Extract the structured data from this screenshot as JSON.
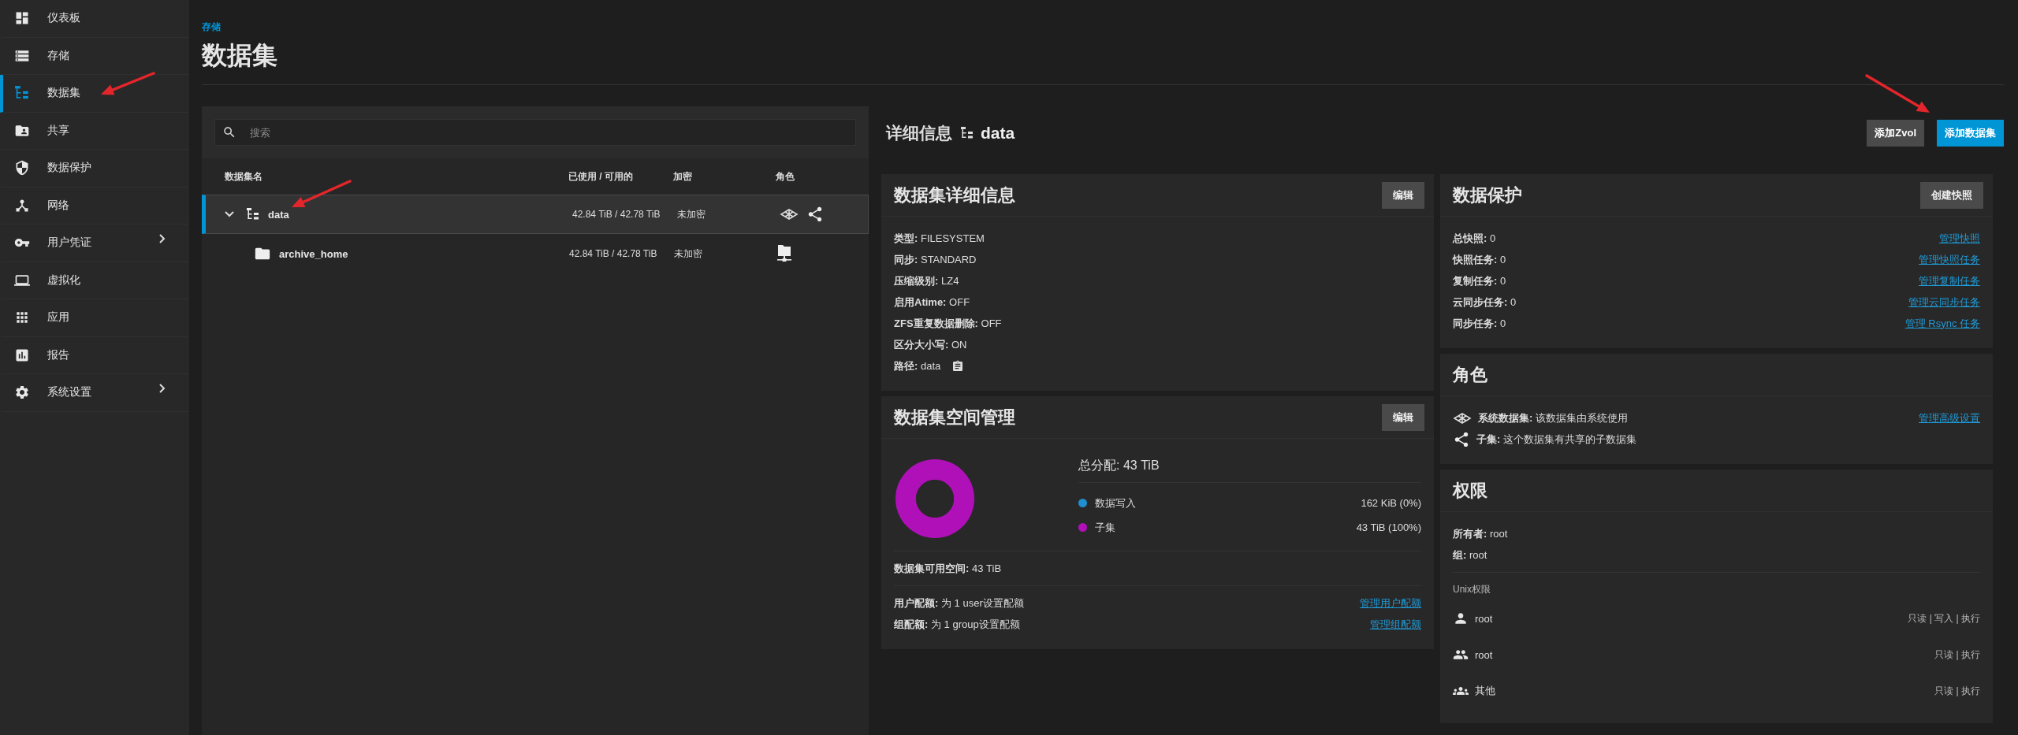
{
  "sidebar": {
    "items": [
      {
        "kind": "dashboard",
        "label": "仪表板",
        "selected": false,
        "chevron": false
      },
      {
        "kind": "storage",
        "label": "存储",
        "selected": false,
        "chevron": false
      },
      {
        "kind": "datasets",
        "label": "数据集",
        "selected": true,
        "chevron": false
      },
      {
        "kind": "shares",
        "label": "共享",
        "selected": false,
        "chevron": false
      },
      {
        "kind": "protection",
        "label": "数据保护",
        "selected": false,
        "chevron": false
      },
      {
        "kind": "network",
        "label": "网络",
        "selected": false,
        "chevron": false
      },
      {
        "kind": "credentials",
        "label": "用户凭证",
        "selected": false,
        "chevron": true
      },
      {
        "kind": "virtualization",
        "label": "虚拟化",
        "selected": false,
        "chevron": false
      },
      {
        "kind": "apps",
        "label": "应用",
        "selected": false,
        "chevron": false
      },
      {
        "kind": "reports",
        "label": "报告",
        "selected": false,
        "chevron": false
      },
      {
        "kind": "settings",
        "label": "系统设置",
        "selected": false,
        "chevron": true
      }
    ]
  },
  "header": {
    "breadcrumb": "存储",
    "title": "数据集"
  },
  "tree": {
    "search": {
      "placeholder": "搜索"
    },
    "columns": [
      "数据集名",
      "已使用 / 可用的",
      "加密",
      "角色"
    ],
    "rows": [
      {
        "kind": "dataset",
        "name": "data",
        "used": "42.84 TiB / 42.78 TiB",
        "encryption": "未加密",
        "selected": true,
        "expanded": true,
        "roles": [
          {
            "kind": "system"
          },
          {
            "kind": "share"
          }
        ],
        "children": [
          {
            "kind": "folder",
            "name": "archive_home",
            "used": "42.84 TiB / 42.78 TiB",
            "encryption": "未加密",
            "selected": false,
            "roles": [
              {
                "kind": "nfs"
              }
            ]
          }
        ]
      }
    ]
  },
  "details": {
    "title": "详细信息",
    "dataset": "data",
    "buttons": [
      {
        "label": "添加Zvol",
        "primary": false
      },
      {
        "label": "添加数据集",
        "primary": true
      }
    ]
  },
  "dataset_details": {
    "title": "数据集详细信息",
    "button": "编辑",
    "fields": [
      {
        "label": "类型:",
        "value": "FILESYSTEM",
        "copyable": false
      },
      {
        "label": "同步:",
        "value": "STANDARD",
        "copyable": false
      },
      {
        "label": "压缩级别:",
        "value": "LZ4",
        "copyable": false
      },
      {
        "label": "启用Atime:",
        "value": "OFF",
        "copyable": false
      },
      {
        "label": "ZFS重复数据删除:",
        "value": "OFF",
        "copyable": false
      },
      {
        "label": "区分大小写:",
        "value": "ON",
        "copyable": false
      },
      {
        "label": "路径:",
        "value": "data",
        "copyable": true
      }
    ]
  },
  "space": {
    "title": "数据集空间管理",
    "button": "编辑",
    "total_label": "总分配:",
    "total": "43 TiB",
    "legend": [
      {
        "value": "162 KiB (0%)",
        "color": "#1f8fd0"
      },
      {
        "value": "43 TiB (100%)",
        "color": "#b010b8"
      }
    ],
    "chart_data": {
      "type": "donut",
      "categories": [
        "数据写入",
        "子集"
      ],
      "values": [
        0,
        100
      ]
    },
    "available_label": "数据集可用空间:",
    "available": "43 TiB",
    "quotas": [
      {
        "label": "用户配额:",
        "value": "为 1 user设置配额",
        "link": "管理用户配额"
      },
      {
        "label": "组配额:",
        "value": "为 1 group设置配额",
        "link": "管理组配额"
      }
    ]
  },
  "protection": {
    "title": "数据保护",
    "button": "创建快照",
    "rows": [
      {
        "label": "总快照:",
        "value": "0",
        "link": "管理快照"
      },
      {
        "label": "快照任务:",
        "value": "0",
        "link": "管理快照任务"
      },
      {
        "label": "复制任务:",
        "value": "0",
        "link": "管理复制任务"
      },
      {
        "label": "云同步任务:",
        "value": "0",
        "link": "管理云同步任务"
      },
      {
        "label": "同步任务:",
        "value": "0",
        "link": "管理 Rsync 任务"
      }
    ]
  },
  "roles": {
    "title": "角色",
    "rows": [
      {
        "kind": "system",
        "label": "系统数据集:",
        "text": "该数据集由系统使用",
        "link": "管理高级设置"
      },
      {
        "kind": "share",
        "label": "子集:",
        "text": "这个数据集有共享的子数据集"
      }
    ]
  },
  "permissions": {
    "title": "权限",
    "owner_label": "所有者:",
    "owner": "root",
    "group_label": "组:",
    "group": "root",
    "unix_label": "Unix权限",
    "entries": [
      {
        "kind": "user",
        "name": "root",
        "access": "只读 | 写入 | 执行"
      },
      {
        "kind": "group",
        "name": "root",
        "access": "只读 | 执行"
      },
      {
        "kind": "other",
        "name": "其他",
        "access": "只读 | 执行"
      }
    ]
  }
}
